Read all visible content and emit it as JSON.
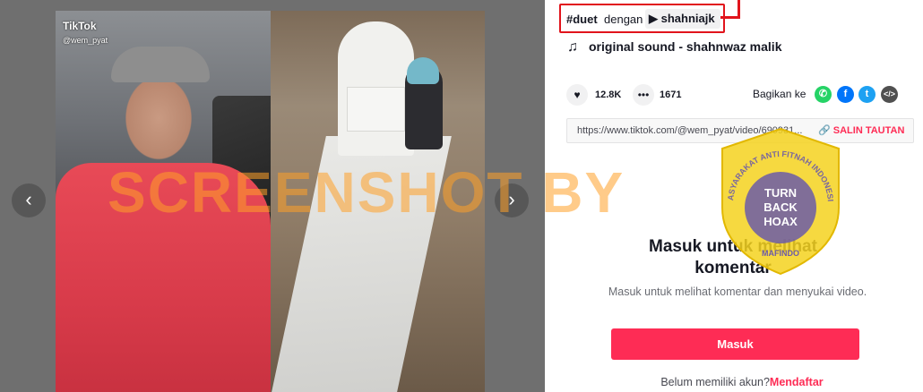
{
  "video": {
    "tiktok_logo": "TikTok",
    "creator_handle": "@wem_pyat",
    "prev_arrow": "‹",
    "next_arrow": "›"
  },
  "caption": {
    "hashtag": "#duet",
    "with_text": "dengan",
    "duet_user": "shahniajk"
  },
  "sound": {
    "title": "original sound - shahnwaz malik"
  },
  "stats": {
    "likes": "12.8K",
    "comments": "1671",
    "share_label": "Bagikan ke"
  },
  "link": {
    "url": "https://www.tiktok.com/@wem_pyat/video/690931...",
    "copy_label": "SALIN TAUTAN"
  },
  "comments_login": {
    "title": "Masuk untuk melihat komentar",
    "description": "Masuk untuk melihat komentar dan menyukai video.",
    "button": "Masuk",
    "signup_prompt": "Belum memiliki akun?",
    "signup_link": "Mendaftar"
  },
  "overlay": {
    "watermark": "SCREENSHOT BY",
    "badge_top_text": "MASYARAKAT ANTI FITNAH INDONESIA",
    "badge_center_lines": [
      "TURN",
      "BACK",
      "HOAX"
    ],
    "badge_bottom_text": "MAFINDO"
  },
  "colors": {
    "brand_pink": "#fe2c55",
    "annotation_red": "#e1141c",
    "badge_yellow": "#f4d21e",
    "badge_purple": "#6b5aa8"
  }
}
